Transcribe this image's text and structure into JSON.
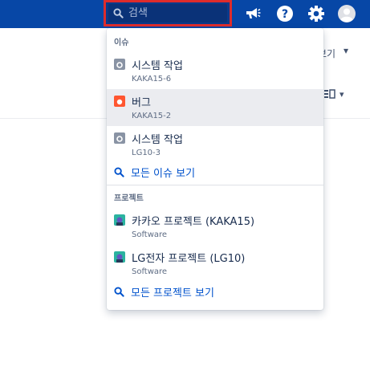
{
  "search": {
    "placeholder": "검색"
  },
  "topbar": {
    "icons": [
      "search-icon",
      "megaphone-icon",
      "help-icon",
      "gear-icon",
      "avatar"
    ]
  },
  "background": {
    "view_label": "보기",
    "chevron": "⌄"
  },
  "dropdown": {
    "issues_header": "이슈",
    "issues": [
      {
        "title": "시스템 작업",
        "key": "KAKA15-6",
        "type": "task",
        "icon_color": "#8993a4"
      },
      {
        "title": "버그",
        "key": "KAKA15-2",
        "type": "bug",
        "icon_color": "#ff5630"
      },
      {
        "title": "시스템 작업",
        "key": "LG10-3",
        "type": "task",
        "icon_color": "#8993a4"
      }
    ],
    "all_issues_link": "모든 이슈 보기",
    "projects_header": "프로젝트",
    "projects": [
      {
        "title": "카카오 프로젝트 (KAKA15)",
        "subtitle": "Software"
      },
      {
        "title": "LG전자 프로젝트 (LG10)",
        "subtitle": "Software"
      }
    ],
    "all_projects_link": "모든 프로젝트 보기"
  },
  "colors": {
    "topbar": "#0747a6",
    "search_highlight": "#de2c2c",
    "link": "#0052cc",
    "selected_row": "#ebecf0"
  }
}
